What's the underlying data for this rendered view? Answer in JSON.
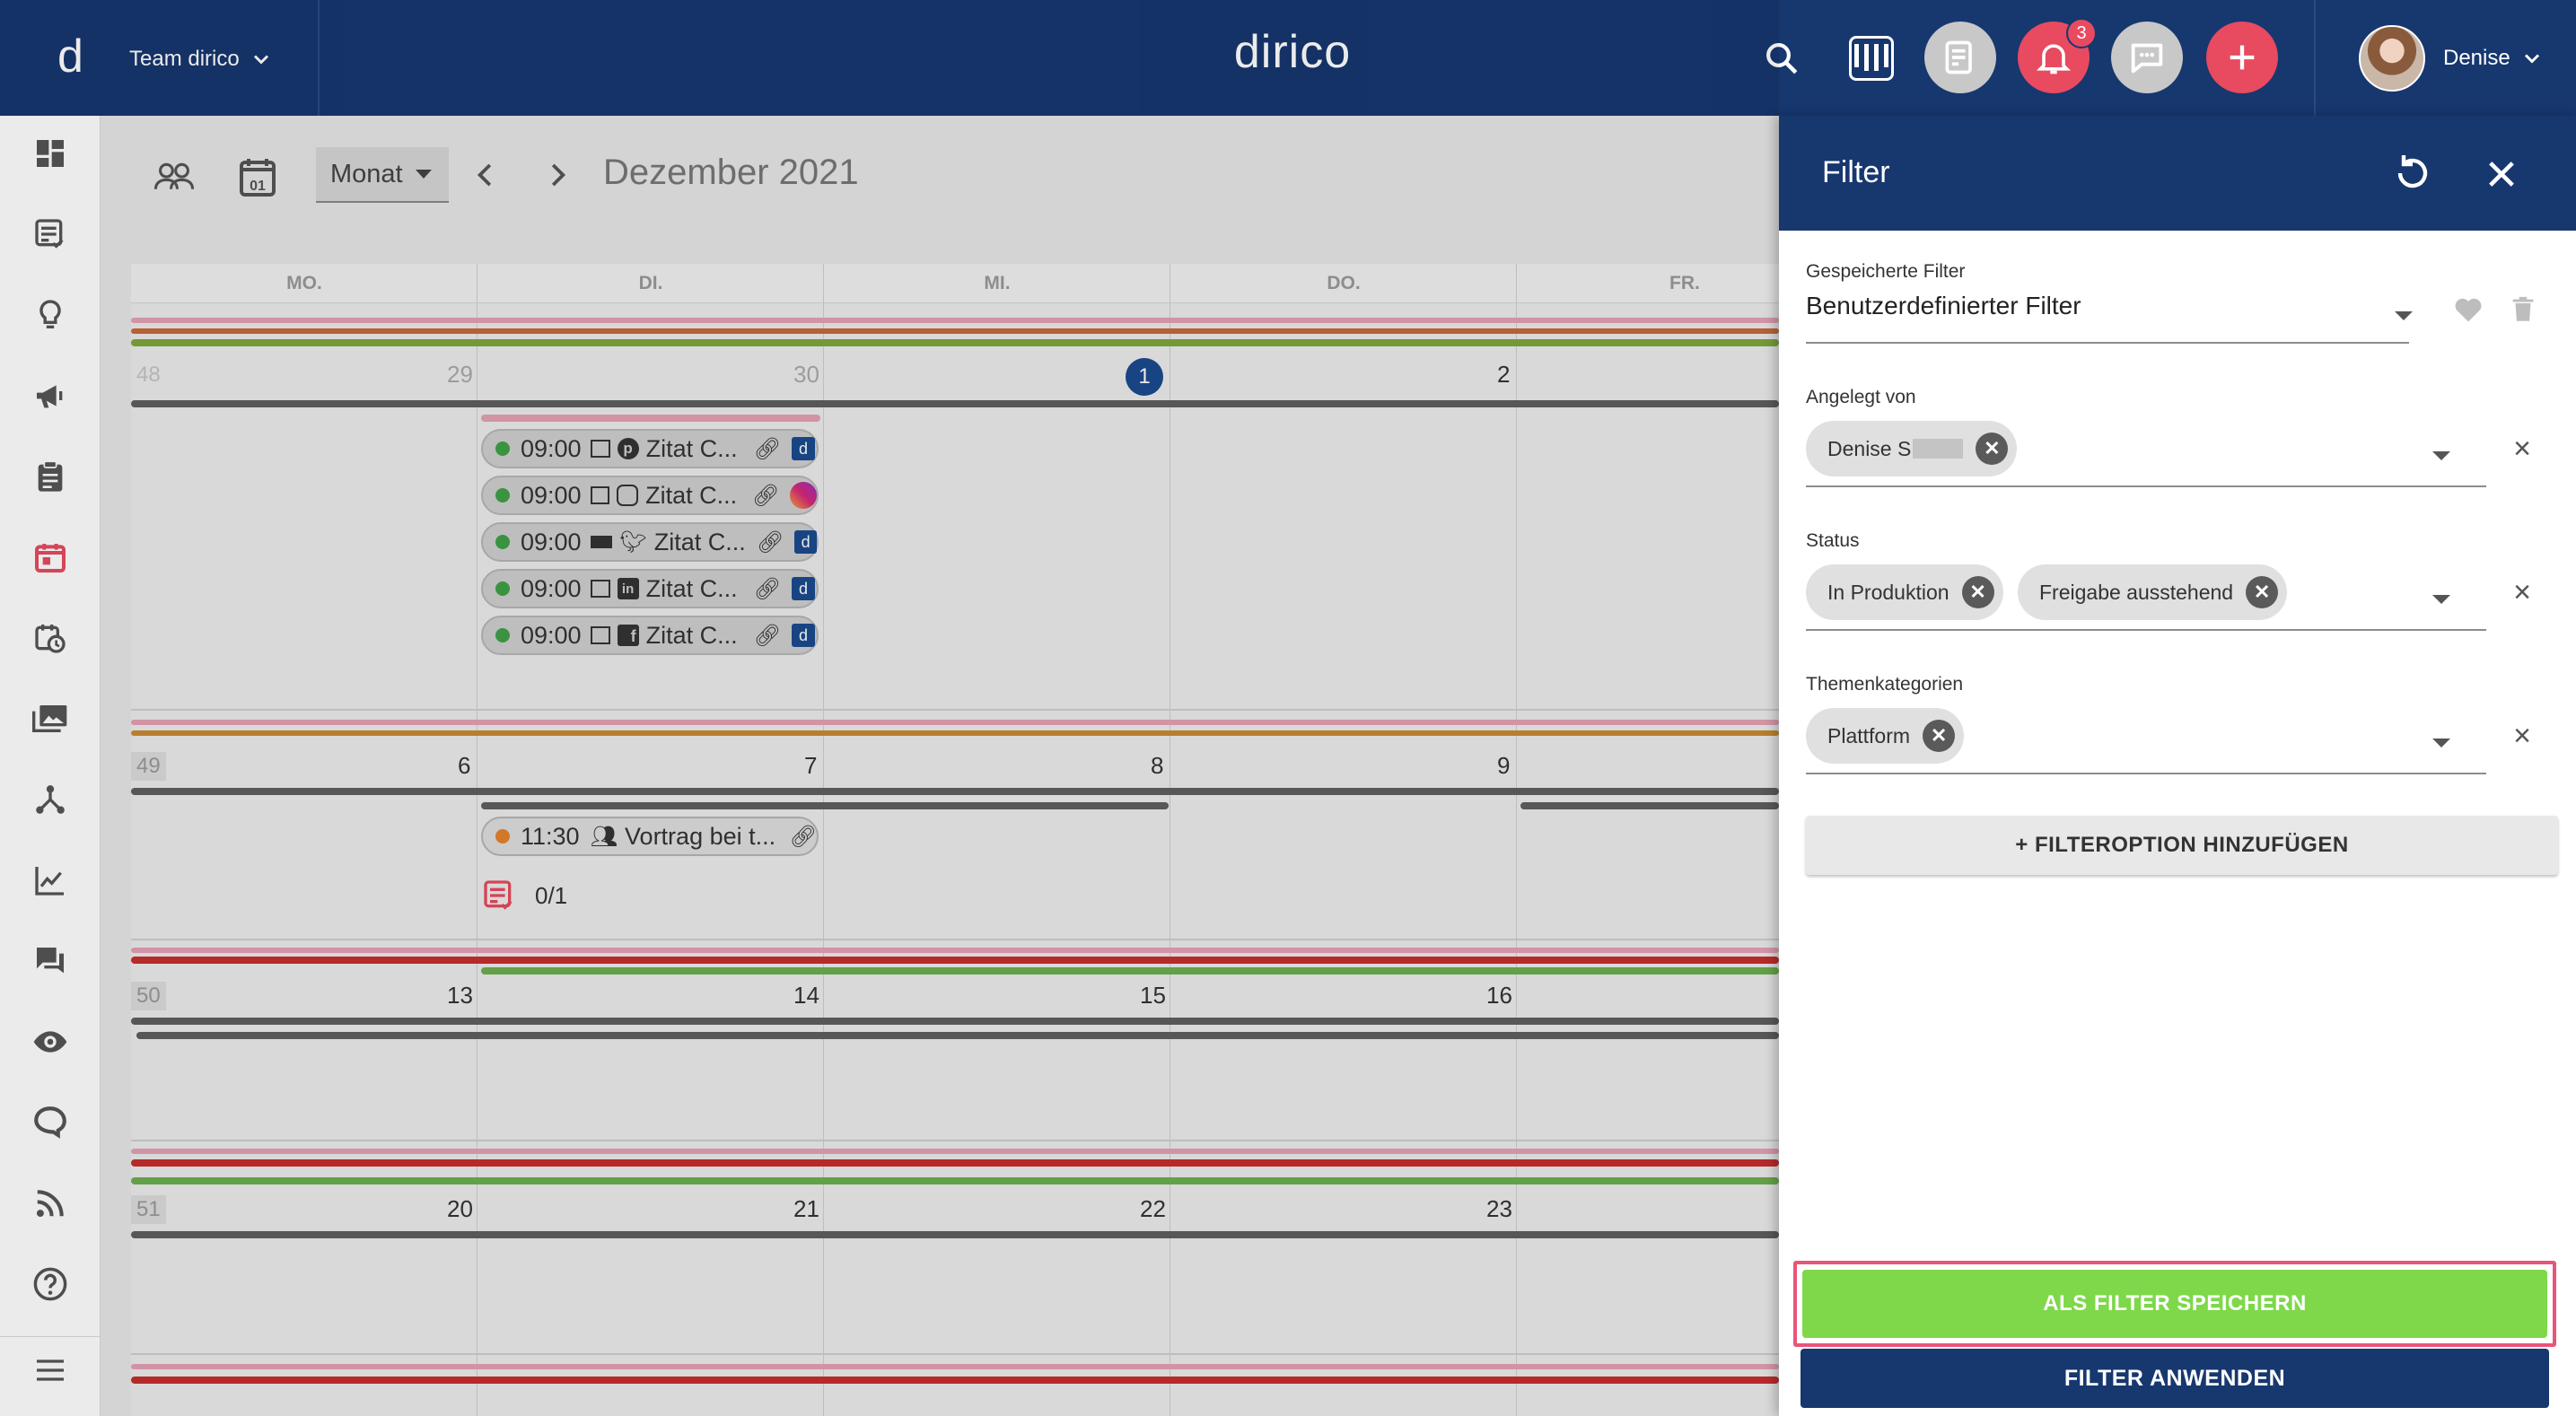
{
  "header": {
    "logo_letter": "d",
    "team": "Team dirico",
    "app_title": "dirico",
    "notifications_count": "3",
    "user_name": "Denise",
    "colors": {
      "bar": "#17376f",
      "accent": "#e84a5f"
    }
  },
  "toolbar": {
    "view_mode": "Monat",
    "month_title": "Dezember 2021"
  },
  "calendar": {
    "weekday_headers": [
      "MO.",
      "DI.",
      "MI.",
      "DO.",
      "FR."
    ],
    "weeks": [
      {
        "week": "48",
        "days": [
          "29",
          "30",
          "1",
          "2",
          ""
        ]
      },
      {
        "week": "49",
        "days": [
          "6",
          "7",
          "8",
          "9",
          ""
        ]
      },
      {
        "week": "50",
        "days": [
          "13",
          "14",
          "15",
          "16",
          ""
        ]
      },
      {
        "week": "51",
        "days": [
          "20",
          "21",
          "22",
          "23",
          ""
        ]
      }
    ],
    "events": [
      {
        "time": "09:00",
        "title": "Zitat C...",
        "network": "pinterest"
      },
      {
        "time": "09:00",
        "title": "Zitat C...",
        "network": "instagram"
      },
      {
        "time": "09:00",
        "title": "Zitat C...",
        "network": "twitter"
      },
      {
        "time": "09:00",
        "title": "Zitat C...",
        "network": "linkedin"
      },
      {
        "time": "09:00",
        "title": "Zitat C...",
        "network": "facebook"
      }
    ],
    "event_week2": {
      "time": "11:30",
      "title": "Vortrag bei t..."
    },
    "task_count": "0/1"
  },
  "filter": {
    "title": "Filter",
    "saved_label": "Gespeicherte Filter",
    "saved_value": "Benutzerdefinierter Filter",
    "created_by_label": "Angelegt von",
    "created_by_chips": [
      "Denise S"
    ],
    "status_label": "Status",
    "status_chips": [
      "In Produktion",
      "Freigabe ausstehend"
    ],
    "topics_label": "Themenkategorien",
    "topics_chips": [
      "Plattform"
    ],
    "add_option": "+ FILTEROPTION HINZUFÜGEN",
    "save_as_filter": "ALS FILTER SPEICHERN",
    "apply_filter": "FILTER ANWENDEN"
  }
}
